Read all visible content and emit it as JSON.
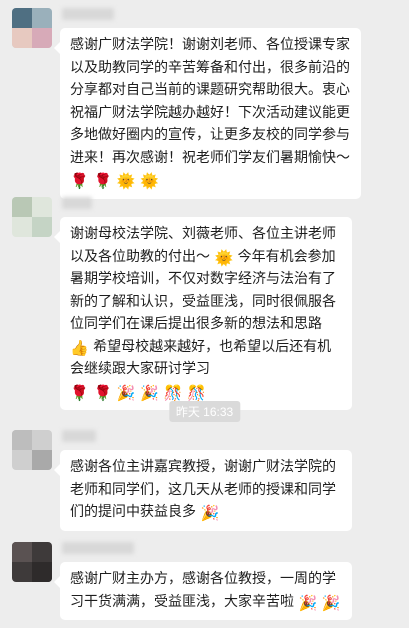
{
  "chat": {
    "timestamp": "昨天 16:33",
    "messages": [
      {
        "text": "感谢广财法学院！谢谢刘老师、各位授课专家以及助教同学的辛苦筹备和付出，很多前沿的分享都对自己当前的课题研究帮助很大。衷心祝福广财法学院越办越好！下次活动建议能更多地做好圈内的宣传，让更多友校的同学参与进来！再次感谢！祝老师们学友们暑期愉快～",
        "emojis": "🌹 🌹 🌞 🌞"
      },
      {
        "text_a": "谢谢母校法学院、刘薇老师、各位主讲老师以及各位助教的付出～",
        "emoji_a": "🌞",
        "text_b": "今年有机会参加暑期学校培训，不仅对数字经济与法治有了新的了解和认识，受益匪浅，同时很佩服各位同学们在课后提出很多新的想法和思路",
        "emoji_b": "👍",
        "text_c": "希望母校越来越好，也希望以后还有机会继续跟大家研讨学习",
        "emojis": "🌹 🌹 🎉 🎉 🎊 🎊"
      },
      {
        "text": "感谢各位主讲嘉宾教授，谢谢广财法学院的老师和同学们，这几天从老师的授课和同学们的提问中获益良多",
        "emojis": "🎉"
      },
      {
        "text": "感谢广财主办方，感谢各位教授，一周的学习干货满满，受益匪浅，大家辛苦啦",
        "emojis": "🎉 🎉"
      }
    ]
  },
  "colors": {
    "background": "#ededed",
    "bubble": "#ffffff",
    "text": "#1e1e1e",
    "timestamp_bg": "#dadada",
    "timestamp_text": "#ffffff"
  }
}
